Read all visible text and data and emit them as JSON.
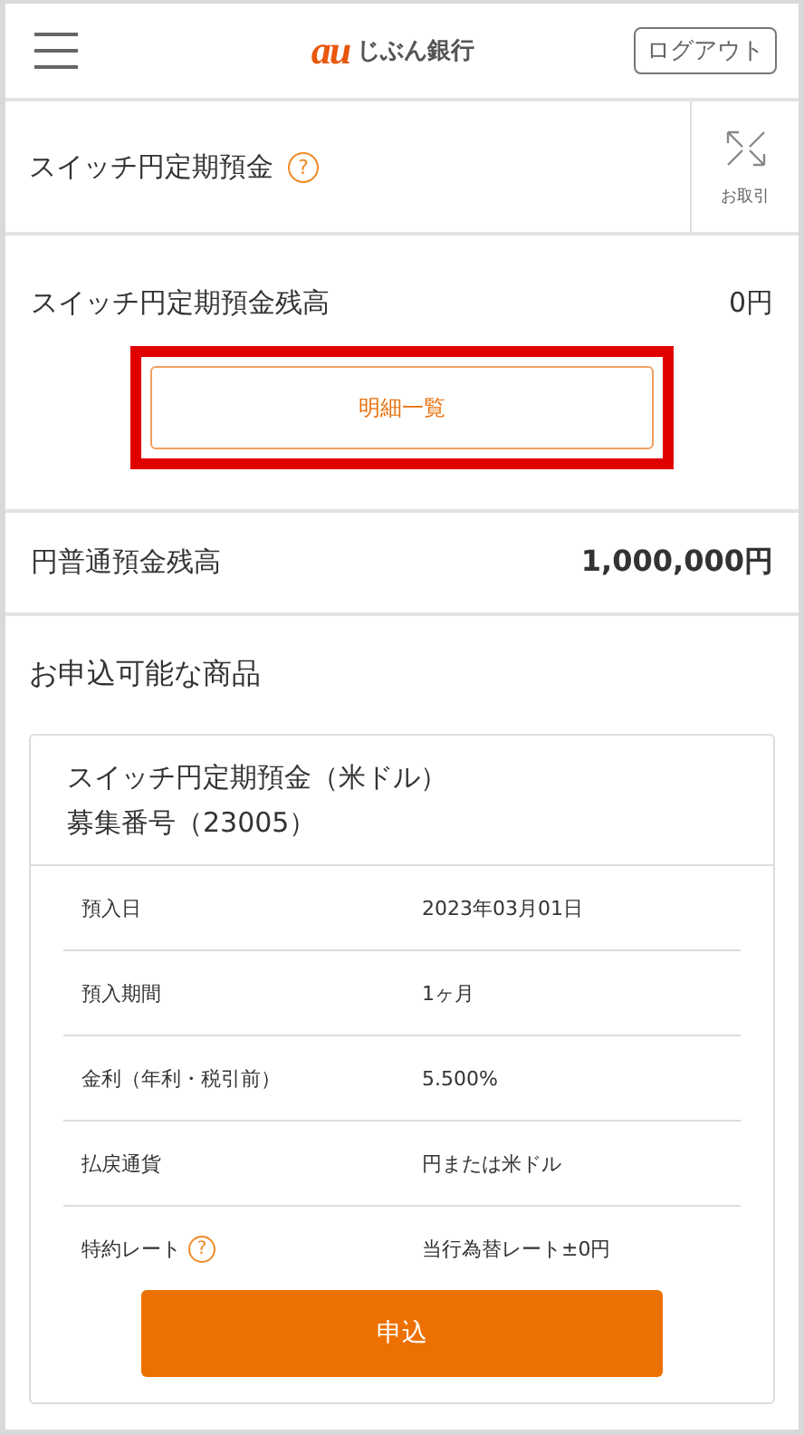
{
  "header": {
    "logo_mark": "au",
    "logo_text": "じぶん銀行",
    "logout_button": "ログアウト"
  },
  "section": {
    "title": "スイッチ円定期預金",
    "help": "?",
    "transaction_link": "お取引"
  },
  "switch_balance": {
    "label": "スイッチ円定期預金残高",
    "amount": "0円",
    "details_button": {
      "label": "明細一覧",
      "highlighted": true
    }
  },
  "yen_balance": {
    "label": "円普通預金残高",
    "amount": "1,000,000円"
  },
  "products": {
    "heading": "お申込可能な商品",
    "card": {
      "title_lines": [
        "スイッチ円定期預金（米ドル）",
        "募集番号（23005）"
      ],
      "rows": [
        {
          "label": "預入日",
          "value": "2023年03月01日"
        },
        {
          "label": "預入期間",
          "value": "1ヶ月"
        },
        {
          "label": "金利（年利・税引前）",
          "value": "5.500%"
        },
        {
          "label": "払戻通貨",
          "value": "円または米ドル"
        },
        {
          "label": "特約レート",
          "help": "?",
          "value": "当行為替レート±0円"
        }
      ],
      "apply_button": "申込"
    }
  }
}
